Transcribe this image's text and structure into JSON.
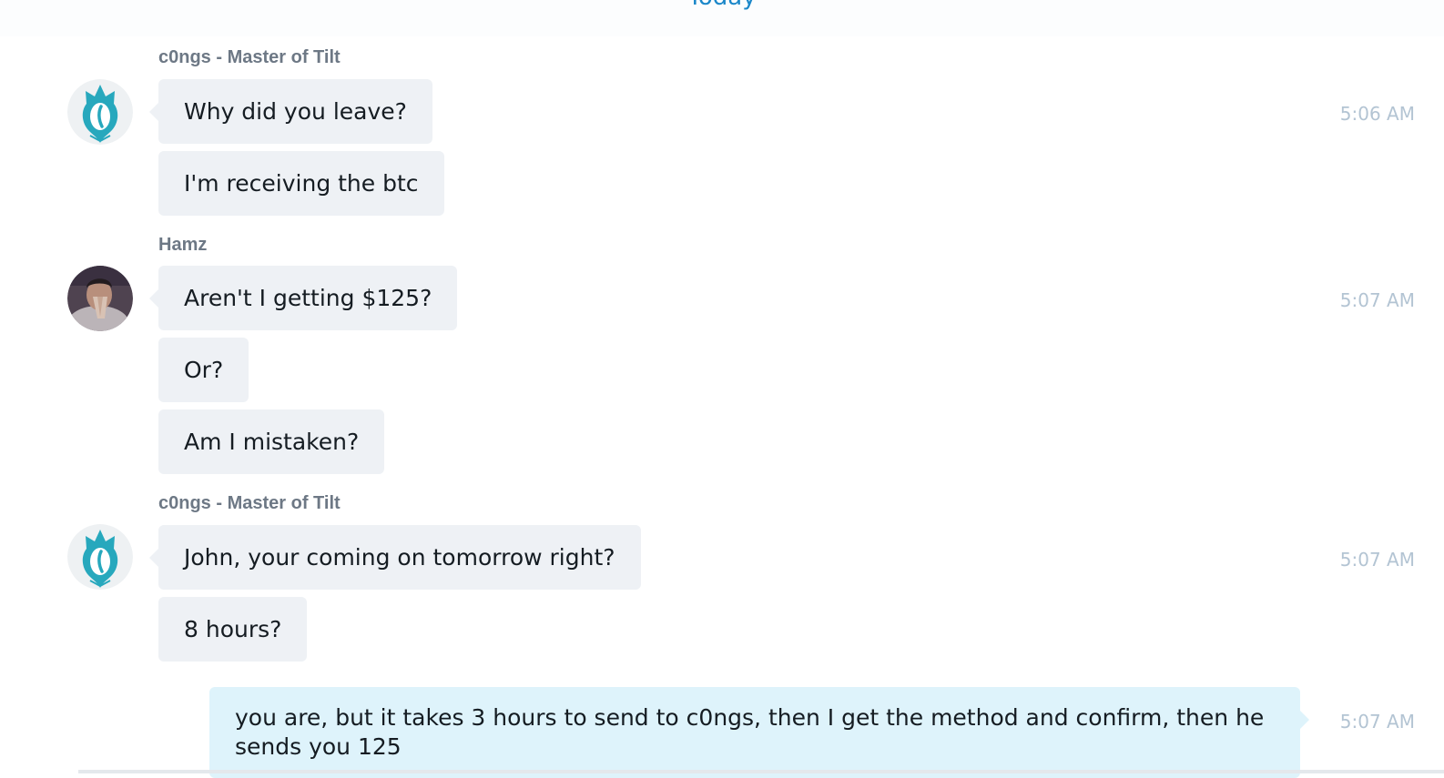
{
  "day_divider": {
    "label": "Today"
  },
  "messages": [
    {
      "sender": "c0ngs - Master of Tilt",
      "avatar_icon": "flame-logo-icon",
      "time": "5:06 AM",
      "lines": [
        "Why did you leave?",
        "I'm receiving the btc"
      ]
    },
    {
      "sender": "Hamz",
      "avatar_icon": "user-photo",
      "time": "5:07 AM",
      "lines": [
        "Aren't I getting $125?",
        "Or?",
        "Am I mistaken?"
      ]
    },
    {
      "sender": "c0ngs - Master of Tilt",
      "avatar_icon": "flame-logo-icon",
      "time": "5:07 AM",
      "lines": [
        "John, your coming on tomorrow right?",
        "8 hours?"
      ]
    },
    {
      "sender": "",
      "own": true,
      "time": "5:07 AM",
      "lines": [
        "you are, but it takes 3 hours to send to c0ngs, then I get the method and confirm, then he sends you 125"
      ]
    }
  ],
  "colors": {
    "accent": "#1b87c9",
    "incoming_bubble": "#eef1f5",
    "outgoing_bubble": "#def3fb",
    "timestamp": "#b3c4d3",
    "sender": "#6d7885",
    "logo": "#27a8bd"
  }
}
